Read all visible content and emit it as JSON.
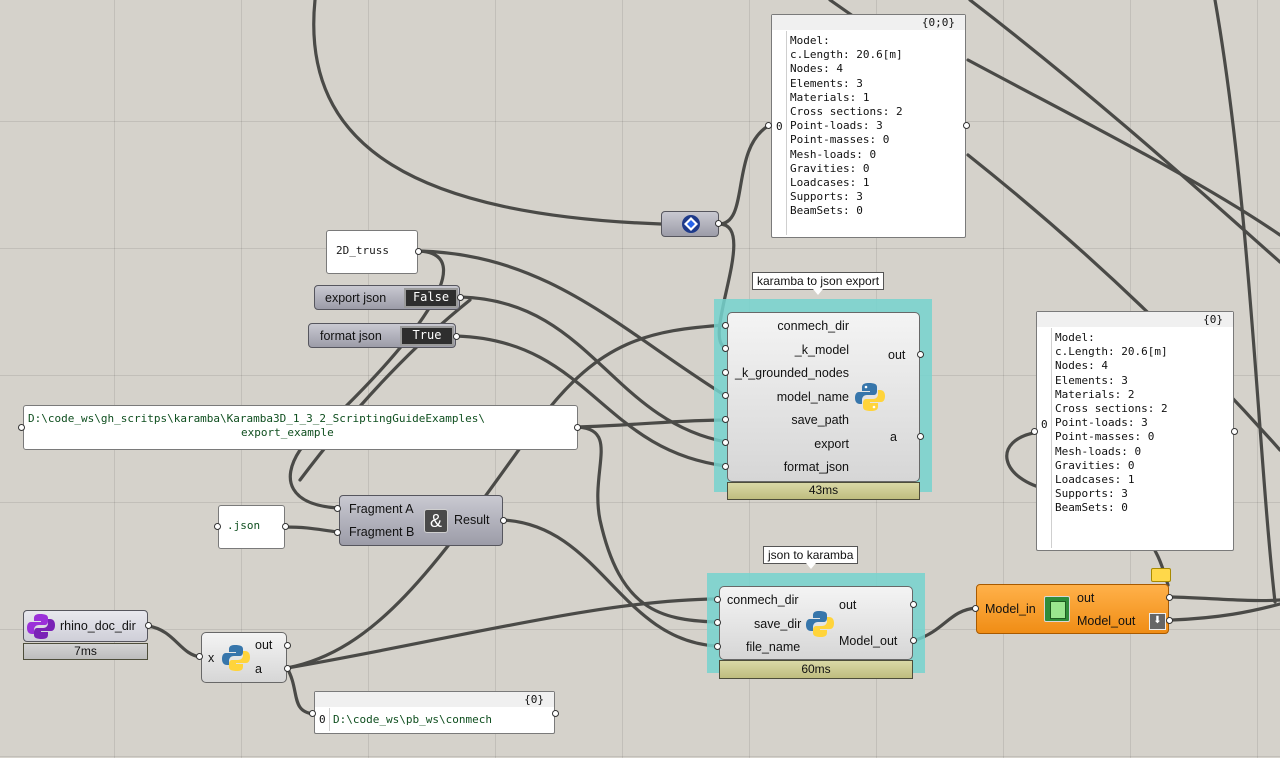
{
  "canvas": {
    "background": "#d5d2cb",
    "selection_color": "#76d3cf"
  },
  "model_panel_top": {
    "header": "{0;0}",
    "index": "0",
    "lines": [
      "Model:",
      "c.Length: 20.6[m]",
      "Nodes: 4",
      "Elements: 3",
      "Materials: 1",
      "Cross sections: 2",
      "Point-loads: 3",
      "Point-masses: 0",
      "Mesh-loads: 0",
      "Gravities: 0",
      "Loadcases: 1",
      "Supports: 3",
      "BeamSets: 0"
    ]
  },
  "model_panel_right": {
    "header": "{0}",
    "index": "0",
    "lines": [
      "Model:",
      "c.Length: 20.6[m]",
      "Nodes: 4",
      "Elements: 3",
      "Materials: 2",
      "Cross sections: 2",
      "Point-loads: 3",
      "Point-masses: 0",
      "Mesh-loads: 0",
      "Gravities: 0",
      "Loadcases: 1",
      "Supports: 3",
      "BeamSets: 0"
    ]
  },
  "panel_2d_truss": {
    "text": "2D_truss"
  },
  "toggle_export": {
    "label": "export json",
    "value": "False"
  },
  "toggle_format": {
    "label": "format json",
    "value": "True"
  },
  "path_panel": {
    "line1": "D:\\code_ws\\gh_scritps\\karamba\\Karamba3D_1_3_2_ScriptingGuideExamples\\",
    "line2": "export_example"
  },
  "json_panel": {
    "text": ".json"
  },
  "concat": {
    "input_a": "Fragment A",
    "input_b": "Fragment B",
    "output": "Result",
    "icon": "ampersand-icon"
  },
  "export_component": {
    "tooltip": "karamba to json export",
    "inputs": [
      "conmech_dir",
      "_k_model",
      "_k_grounded_nodes",
      "model_name",
      "save_path",
      "export",
      "format_json"
    ],
    "outputs": [
      "out",
      "a"
    ],
    "time": "43ms"
  },
  "import_component": {
    "tooltip": "json to karamba",
    "inputs": [
      "conmech_dir",
      "save_dir",
      "file_name"
    ],
    "outputs": [
      "out",
      "Model_out"
    ],
    "time": "60ms"
  },
  "rhino_doc": {
    "label": "rhino_doc_dir",
    "time": "7ms"
  },
  "python_small": {
    "input": "x",
    "outputs": [
      "out",
      "a"
    ]
  },
  "result_panel": {
    "header": "{0}",
    "index": "0",
    "text": "D:\\code_ws\\pb_ws\\conmech"
  },
  "disassemble_model": {
    "input": "Model_in",
    "outputs": [
      "out",
      "Model_out"
    ]
  }
}
